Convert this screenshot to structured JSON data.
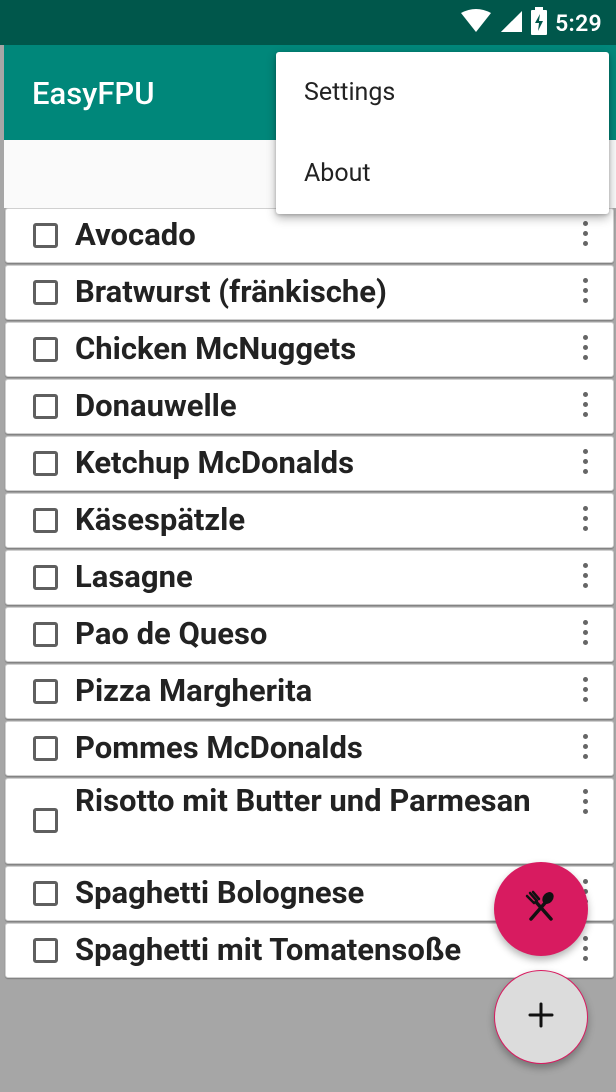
{
  "status_bar": {
    "time": "5:29"
  },
  "app_bar": {
    "title": "EasyFPU"
  },
  "menu": {
    "items": [
      {
        "label": "Settings"
      },
      {
        "label": "About"
      }
    ]
  },
  "food_list": [
    {
      "name": "Avocado",
      "checked": false
    },
    {
      "name": "Bratwurst (fränkische)",
      "checked": false
    },
    {
      "name": "Chicken McNuggets",
      "checked": false
    },
    {
      "name": "Donauwelle",
      "checked": false
    },
    {
      "name": "Ketchup McDonalds",
      "checked": false
    },
    {
      "name": "Käsespätzle",
      "checked": false
    },
    {
      "name": "Lasagne",
      "checked": false
    },
    {
      "name": "Pao de Queso",
      "checked": false
    },
    {
      "name": "Pizza Margherita",
      "checked": false
    },
    {
      "name": "Pommes McDonalds",
      "checked": false
    },
    {
      "name": "Risotto mit Butter und Parmesan",
      "checked": false
    },
    {
      "name": "Spaghetti Bolognese",
      "checked": false
    },
    {
      "name": "Spaghetti mit Tomatensoße",
      "checked": false
    }
  ],
  "fabs": {
    "meal_icon": "fork-spoon-icon",
    "add_icon": "plus-icon"
  },
  "colors": {
    "primary": "#00877a",
    "primary_dark": "#00574b",
    "accent": "#d81b60"
  }
}
